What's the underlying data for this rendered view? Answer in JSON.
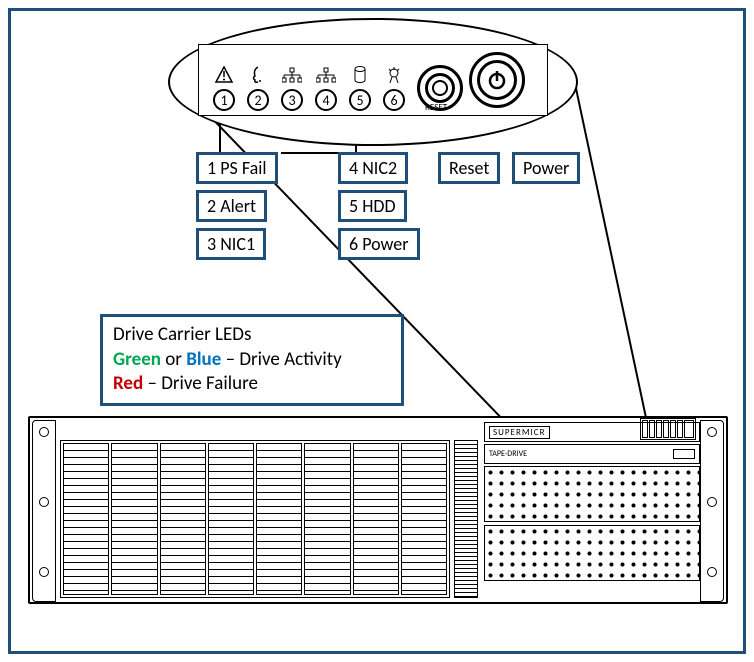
{
  "callouts": {
    "c1": "1 PS Fail",
    "c2": "2 Alert",
    "c3": "3 NIC1",
    "c4": "4 NIC2",
    "c5": "5 HDD",
    "c6": "6 Power",
    "reset": "Reset",
    "power": "Power"
  },
  "panel": {
    "nums": [
      "1",
      "2",
      "3",
      "4",
      "5",
      "6"
    ],
    "reset_label": "RESET"
  },
  "infobox": {
    "title": "Drive Carrier LEDs",
    "green": "Green",
    "or": " or ",
    "blue": "Blue",
    "activity": " – Drive Activity",
    "red": "Red",
    "failure": " – Drive Failure"
  },
  "brand": "SUPERMICR",
  "tape_label": "TAPE-DRIVE",
  "icon_names": [
    "psfail-icon",
    "alert-icon",
    "nic1-icon",
    "nic2-icon",
    "hdd-icon",
    "powerled-icon"
  ]
}
